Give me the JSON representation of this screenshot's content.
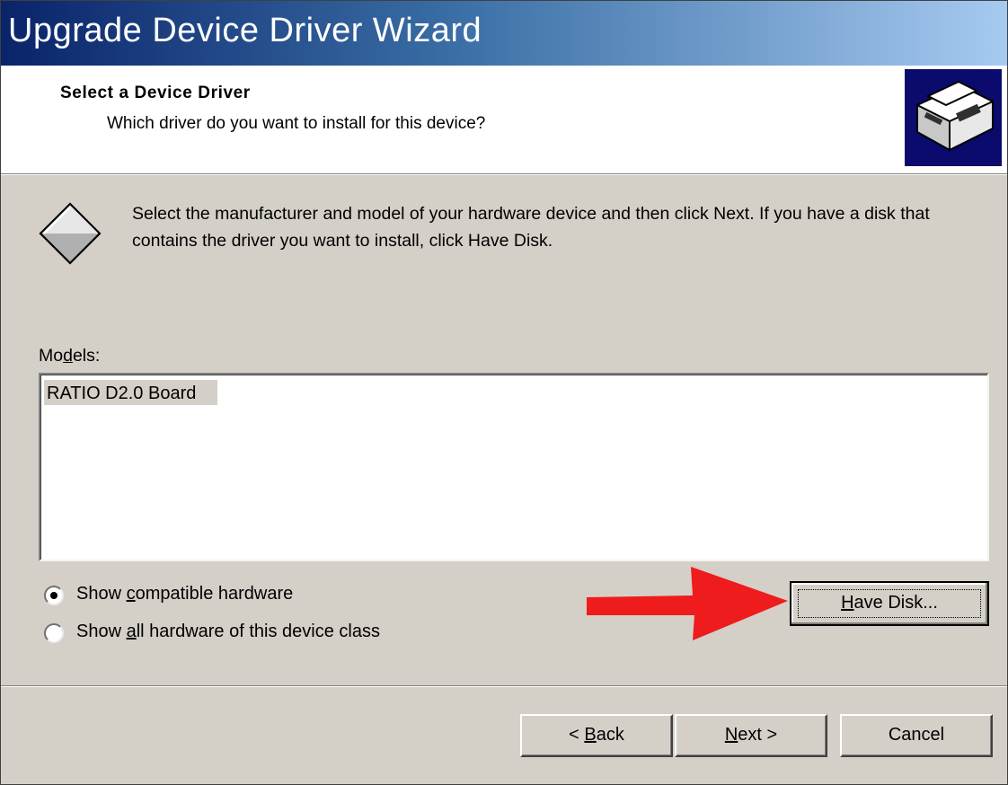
{
  "window": {
    "title": "Upgrade Device Driver Wizard"
  },
  "header": {
    "title": "Select a Device Driver",
    "subtitle": "Which driver do you want to install for this device?",
    "icon": "hardware-install-icon"
  },
  "body": {
    "icon": "diamond-info-icon",
    "description": "Select the manufacturer and model of your hardware device and then click Next. If you have a disk that contains the driver you want to install, click Have Disk."
  },
  "models": {
    "label_prefix": "Mo",
    "label_accel": "d",
    "label_suffix": "els:",
    "items": [
      {
        "label": "RATIO D2.0 Board",
        "selected": true
      }
    ]
  },
  "radios": [
    {
      "prefix": "Show ",
      "accel": "c",
      "suffix": "ompatible hardware",
      "checked": true
    },
    {
      "prefix": "Show ",
      "accel": "a",
      "suffix": "ll hardware of this device class",
      "checked": false
    }
  ],
  "buttons": {
    "have_disk": {
      "accel": "H",
      "suffix": "ave Disk..."
    },
    "back": {
      "prefix": "< ",
      "accel": "B",
      "suffix": "ack"
    },
    "next": {
      "accel": "N",
      "suffix": "ext >"
    },
    "cancel": {
      "label": "Cancel"
    }
  },
  "annotation": {
    "icon": "red-arrow-icon",
    "color": "#ee1c1c"
  }
}
